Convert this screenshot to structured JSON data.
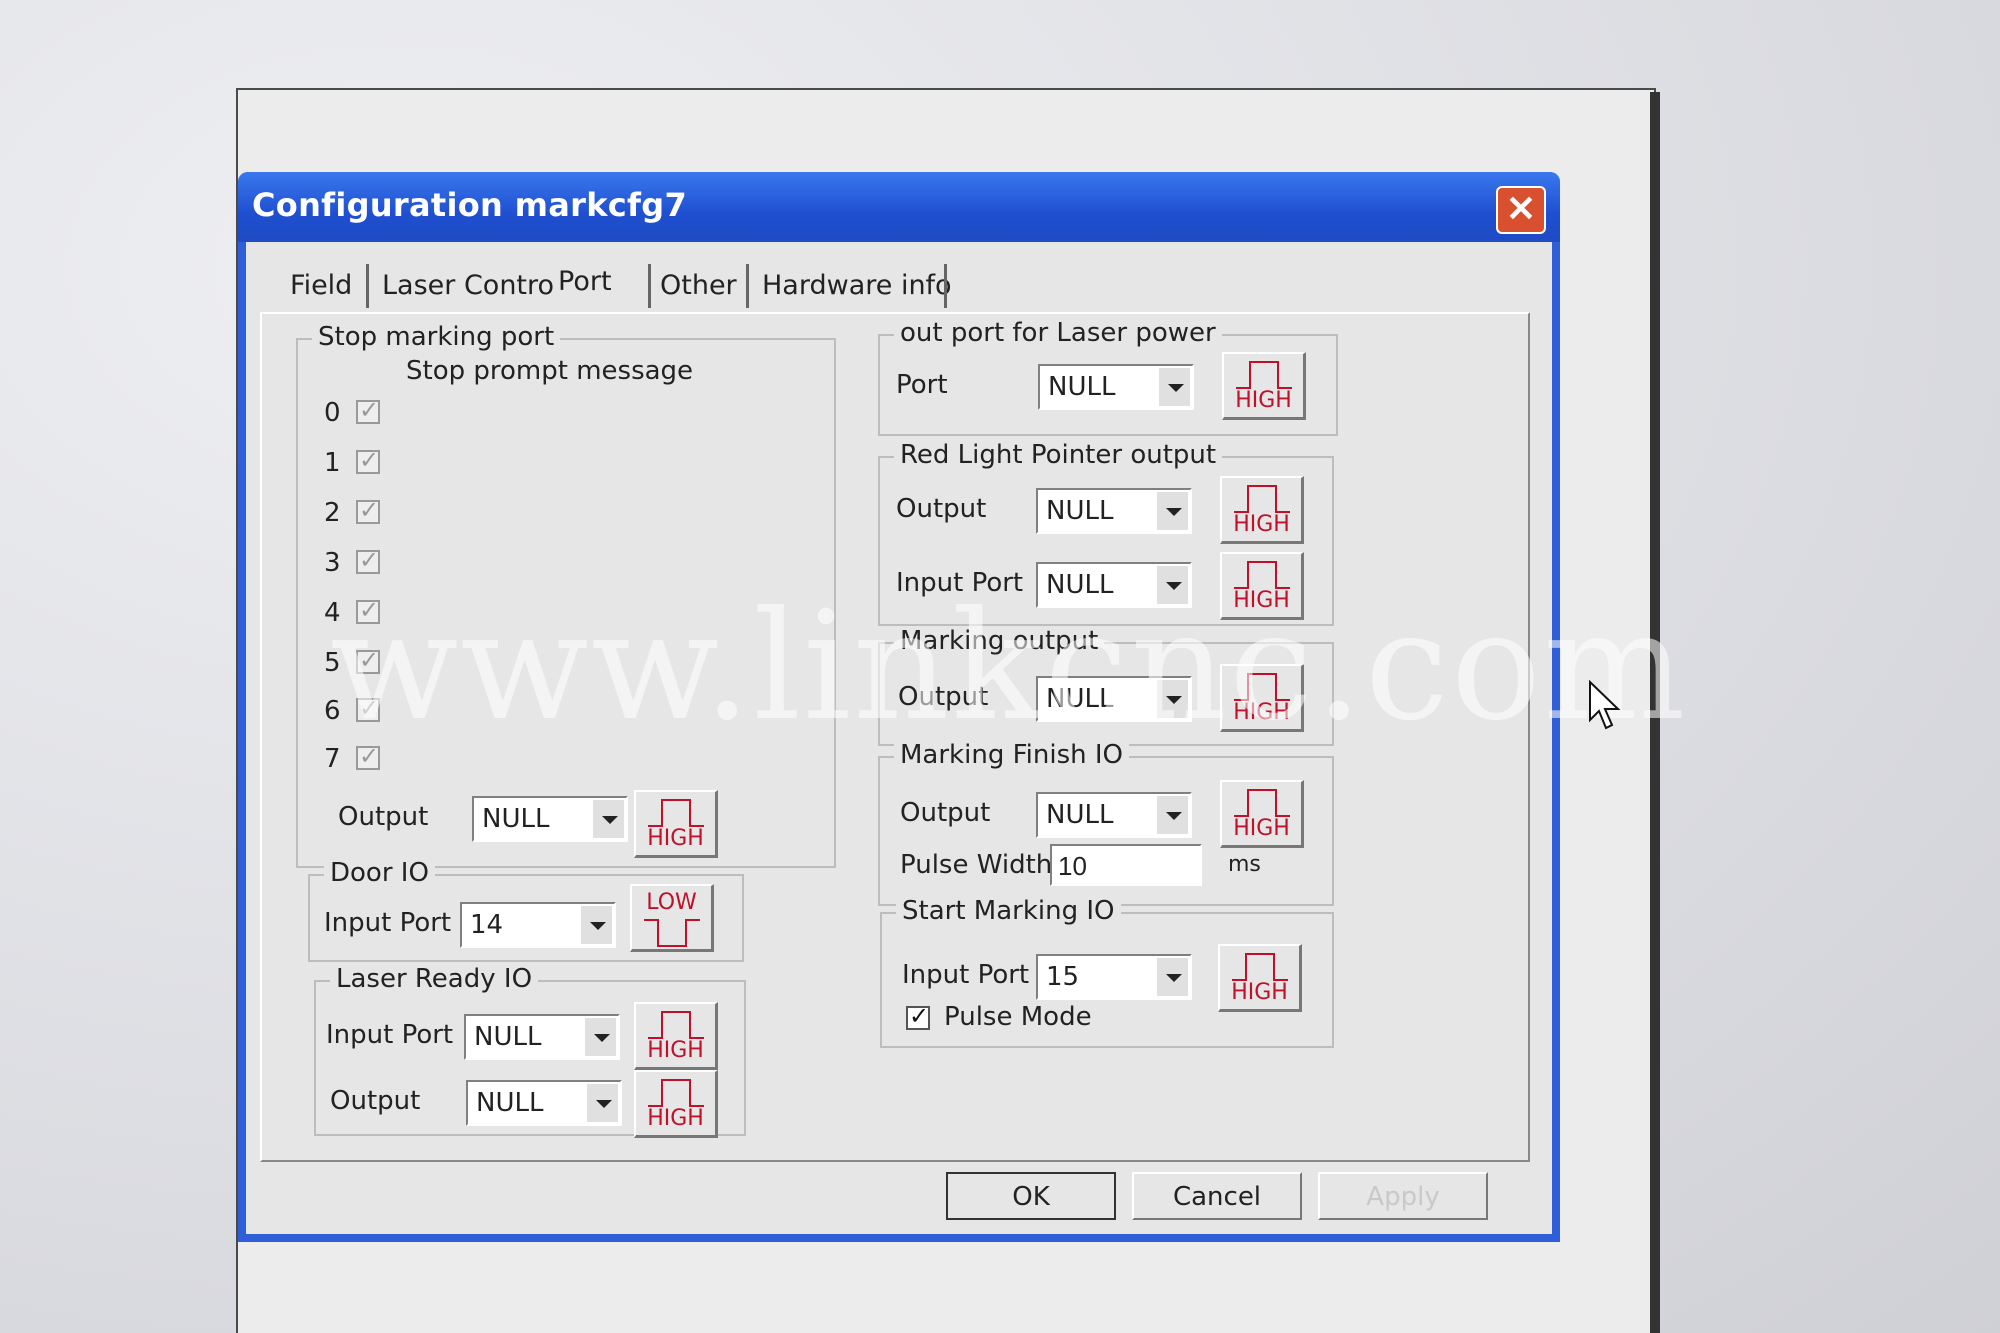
{
  "window": {
    "title": "Configuration markcfg7"
  },
  "tabs": [
    "Field",
    "Laser Contro",
    "Port",
    "Other",
    "Hardware info"
  ],
  "stop_marking": {
    "title": "Stop marking port",
    "prompt": "Stop prompt message",
    "bits": [
      "0",
      "1",
      "2",
      "3",
      "4",
      "5",
      "6",
      "7"
    ],
    "output_label": "Output",
    "output_value": "NULL",
    "output_level": "HIGH"
  },
  "door_io": {
    "title": "Door IO",
    "input_label": "Input Port",
    "input_value": "14",
    "input_level": "LOW"
  },
  "laser_ready": {
    "title": "Laser Ready IO",
    "input_label": "Input Port",
    "input_value": "NULL",
    "input_level": "HIGH",
    "output_label": "Output",
    "output_value": "NULL",
    "output_level": "HIGH"
  },
  "laser_power": {
    "title": "out port for Laser power",
    "port_label": "Port",
    "port_value": "NULL",
    "port_level": "HIGH"
  },
  "red_light": {
    "title": "Red Light Pointer output",
    "output_label": "Output",
    "output_value": "NULL",
    "output_level": "HIGH",
    "input_label": "Input Port",
    "input_value": "NULL",
    "input_level": "HIGH"
  },
  "marking_output": {
    "title": "Marking output",
    "output_label": "Output",
    "output_value": "NULL",
    "output_level": "HIGH"
  },
  "marking_finish": {
    "title": "Marking Finish IO",
    "output_label": "Output",
    "output_value": "NULL",
    "output_level": "HIGH",
    "pulse_label": "Pulse Width",
    "pulse_value": "10",
    "pulse_unit": "ms"
  },
  "start_marking": {
    "title": "Start Marking IO",
    "input_label": "Input Port",
    "input_value": "15",
    "input_level": "HIGH",
    "pulse_mode_label": "Pulse Mode"
  },
  "buttons": {
    "ok": "OK",
    "cancel": "Cancel",
    "apply": "Apply"
  },
  "watermark": "www.linkcnc.com"
}
